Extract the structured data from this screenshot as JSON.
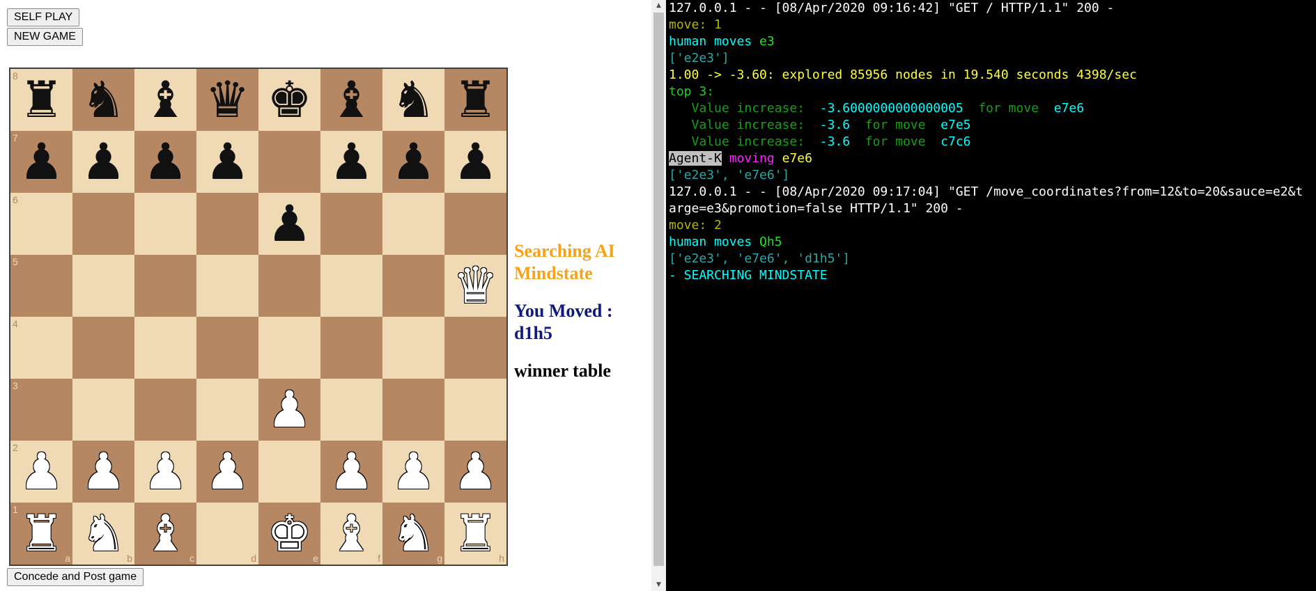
{
  "buttons": {
    "self_play": "SELF PLAY",
    "new_game": "NEW GAME",
    "concede": "Concede and Post game"
  },
  "board": {
    "files": [
      "a",
      "b",
      "c",
      "d",
      "e",
      "f",
      "g",
      "h"
    ],
    "ranks": [
      "8",
      "7",
      "6",
      "5",
      "4",
      "3",
      "2",
      "1"
    ],
    "position": [
      [
        "bR",
        "bN",
        "bB",
        "bQ",
        "bK",
        "bB",
        "bN",
        "bR"
      ],
      [
        "bP",
        "bP",
        "bP",
        "bP",
        "",
        "bP",
        "bP",
        "bP"
      ],
      [
        "",
        "",
        "",
        "",
        "bP",
        "",
        "",
        ""
      ],
      [
        "",
        "",
        "",
        "",
        "",
        "",
        "",
        "wQ"
      ],
      [
        "",
        "",
        "",
        "",
        "",
        "",
        "",
        ""
      ],
      [
        "",
        "",
        "",
        "",
        "wP",
        "",
        "",
        ""
      ],
      [
        "wP",
        "wP",
        "wP",
        "wP",
        "",
        "wP",
        "wP",
        "wP"
      ],
      [
        "wR",
        "wN",
        "wB",
        "",
        "wK",
        "wB",
        "wN",
        "wR"
      ]
    ],
    "light_color": "#f0d9b5",
    "dark_color": "#b58863"
  },
  "status": {
    "searching": "Searching AI Mindstate",
    "you_moved": "You Moved : d1h5",
    "winner_table": "winner table"
  },
  "terminal": {
    "lines": [
      [
        {
          "t": "127.0.0.1 - - [08/Apr/2020 09:16:42] \"GET / HTTP/1.1\" 200 -",
          "c": "white"
        }
      ],
      [
        {
          "t": "move: 1",
          "c": "olive"
        }
      ],
      [
        {
          "t": "human moves ",
          "c": "cyan"
        },
        {
          "t": "e3",
          "c": "lime"
        }
      ],
      [
        {
          "t": "['e2e3']",
          "c": "teal"
        }
      ],
      [
        {
          "t": "1.00 -> -3.60: explored 85956 nodes in 19.540 seconds 4398/sec",
          "c": "yellow"
        }
      ],
      [
        {
          "t": "top 3:",
          "c": "green"
        }
      ],
      [
        {
          "t": "   Value increase:  ",
          "c": "darkgreen"
        },
        {
          "t": "-3.6000000000000005",
          "c": "cyan"
        },
        {
          "t": "  for move  ",
          "c": "darkgreen"
        },
        {
          "t": "e7e6",
          "c": "cyan"
        }
      ],
      [
        {
          "t": "   Value increase:  ",
          "c": "darkgreen"
        },
        {
          "t": "-3.6",
          "c": "cyan"
        },
        {
          "t": "  for move  ",
          "c": "darkgreen"
        },
        {
          "t": "e7e5",
          "c": "cyan"
        }
      ],
      [
        {
          "t": "   Value increase:  ",
          "c": "darkgreen"
        },
        {
          "t": "-3.6",
          "c": "cyan"
        },
        {
          "t": "  for move  ",
          "c": "darkgreen"
        },
        {
          "t": "c7c6",
          "c": "cyan"
        }
      ],
      [
        {
          "t": "Agent-K",
          "c": "hl"
        },
        {
          "t": " moving ",
          "c": "magenta"
        },
        {
          "t": "e7e6",
          "c": "yellow"
        }
      ],
      [
        {
          "t": "['e2e3', 'e7e6']",
          "c": "teal"
        }
      ],
      [
        {
          "t": "127.0.0.1 - - [08/Apr/2020 09:17:04] \"GET /move_coordinates?from=12&to=20&sauce=e2&t",
          "c": "white"
        }
      ],
      [
        {
          "t": "arge=e3&promotion=false HTTP/1.1\" 200 -",
          "c": "white"
        }
      ],
      [
        {
          "t": "move: 2",
          "c": "olive"
        }
      ],
      [
        {
          "t": "human moves ",
          "c": "cyan"
        },
        {
          "t": "Qh5",
          "c": "lime"
        }
      ],
      [
        {
          "t": "['e2e3', 'e7e6', 'd1h5']",
          "c": "teal"
        }
      ],
      [
        {
          "t": "- SEARCHING MINDSTATE",
          "c": "cyan"
        }
      ]
    ]
  }
}
